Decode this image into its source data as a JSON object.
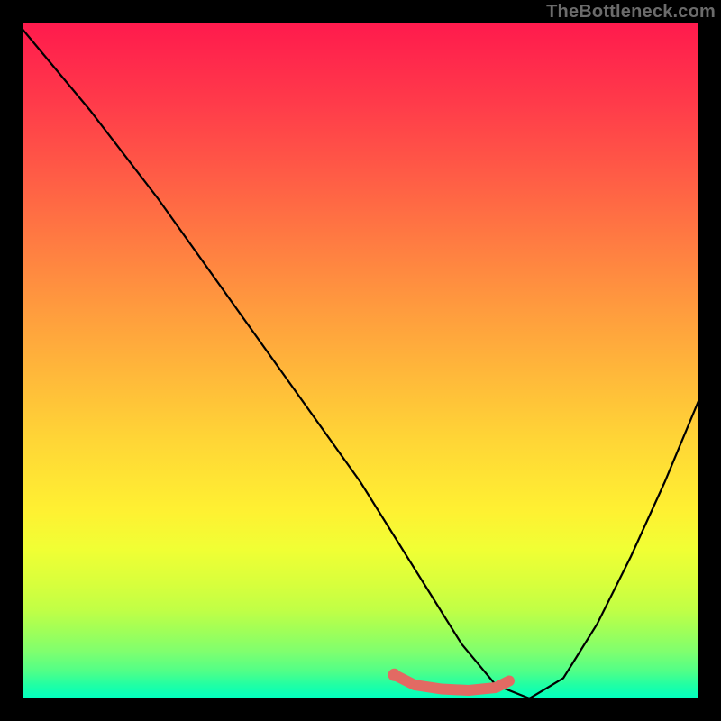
{
  "watermark": "TheBottleneck.com",
  "chart_data": {
    "type": "line",
    "title": "",
    "xlabel": "",
    "ylabel": "",
    "xlim": [
      0,
      100
    ],
    "ylim": [
      0,
      100
    ],
    "series": [
      {
        "name": "black-v-curve",
        "color": "#000000",
        "x": [
          0,
          10,
          20,
          30,
          40,
          50,
          55,
          60,
          65,
          70,
          75,
          80,
          85,
          90,
          95,
          100
        ],
        "values": [
          99,
          87,
          74,
          60,
          46,
          32,
          24,
          16,
          8,
          2,
          0,
          3,
          11,
          21,
          32,
          44
        ]
      },
      {
        "name": "coral-trough-marker",
        "color": "#e26a63",
        "x": [
          55,
          58,
          62,
          66,
          70,
          72
        ],
        "values": [
          3.5,
          2.0,
          1.4,
          1.2,
          1.6,
          2.6
        ]
      }
    ],
    "background_gradient": {
      "top": "#ff1a4d",
      "mid": "#ffe633",
      "bottom": "#00ffc0"
    }
  }
}
